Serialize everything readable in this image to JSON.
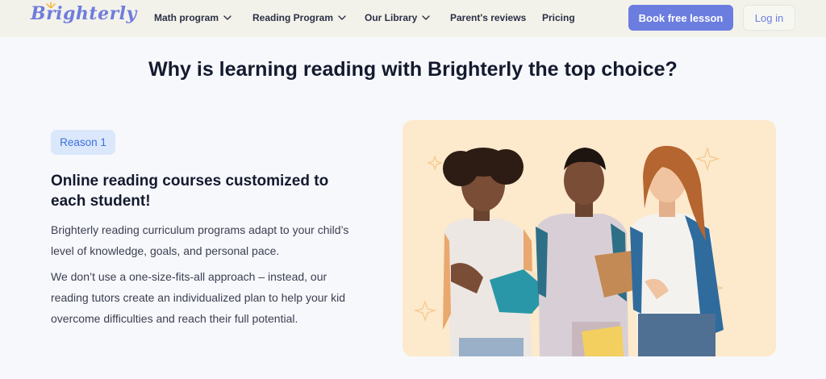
{
  "header": {
    "logo_text": "Brighterly",
    "nav": [
      {
        "label": "Math program",
        "dropdown": true
      },
      {
        "label": "Reading Program",
        "dropdown": true
      },
      {
        "label": "Our Library",
        "dropdown": true
      },
      {
        "label": "Parent's reviews",
        "dropdown": false
      },
      {
        "label": "Pricing",
        "dropdown": false
      }
    ],
    "book_button": "Book free lesson",
    "login_button": "Log in"
  },
  "section": {
    "title": "Why is learning reading with Brighterly the top choice?",
    "badge": "Reason 1",
    "feature_title": "Online reading courses customized to each student!",
    "paragraph_1": "Brighterly reading curriculum programs adapt to your child’s level of knowledge, goals, and personal pace.",
    "paragraph_2": "We don’t use a one-size-fits-all approach – instead, our reading tutors create an individualized plan to help your kid overcome difficulties and reach their full potential."
  },
  "colors": {
    "accent": "#6c7de0",
    "header_bg": "#f3f2ea",
    "badge_bg": "#dbe7fb",
    "badge_text": "#3c70e0",
    "photo_bg": "#fde9cc"
  }
}
